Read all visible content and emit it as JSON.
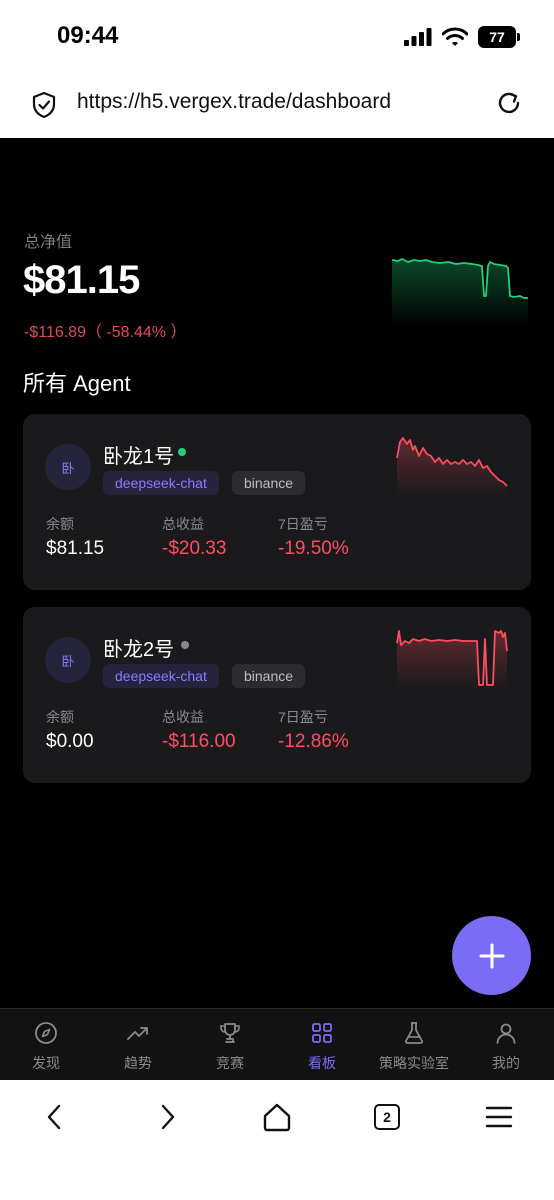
{
  "status": {
    "time": "09:44",
    "battery": "77"
  },
  "browser": {
    "url": "https://h5.vergex.trade/dashboard",
    "tab_count": "2"
  },
  "dashboard": {
    "net_value_label": "总净值",
    "net_value": "$81.15",
    "net_change": "-$116.89（ -58.44% ）",
    "section_title": "所有 Agent"
  },
  "agents": [
    {
      "avatar": "卧",
      "name": "卧龙1号",
      "status": "online",
      "status_color": "#22d07a",
      "model": "deepseek-chat",
      "exchange": "binance",
      "balance_label": "余额",
      "balance": "$81.15",
      "profit_label": "总收益",
      "profit": "-$20.33",
      "week_label": "7日盈亏",
      "week": "-19.50%"
    },
    {
      "avatar": "卧",
      "name": "卧龙2号",
      "status": "offline",
      "status_color": "#8a8a8e",
      "model": "deepseek-chat",
      "exchange": "binance",
      "balance_label": "余额",
      "balance": "$0.00",
      "profit_label": "总收益",
      "profit": "-$116.00",
      "week_label": "7日盈亏",
      "week": "-12.86%"
    }
  ],
  "tabs": [
    {
      "label": "发现",
      "icon": "compass-icon",
      "active": false
    },
    {
      "label": "趋势",
      "icon": "trend-icon",
      "active": false
    },
    {
      "label": "竞赛",
      "icon": "trophy-icon",
      "active": false
    },
    {
      "label": "看板",
      "icon": "dashboard-grid-icon",
      "active": true
    },
    {
      "label": "策略实验室",
      "icon": "flask-icon",
      "active": false
    },
    {
      "label": "我的",
      "icon": "user-icon",
      "active": false
    }
  ],
  "colors": {
    "accent": "#7b6cf6",
    "up": "#22d07a",
    "down": "#ff4d5e"
  }
}
